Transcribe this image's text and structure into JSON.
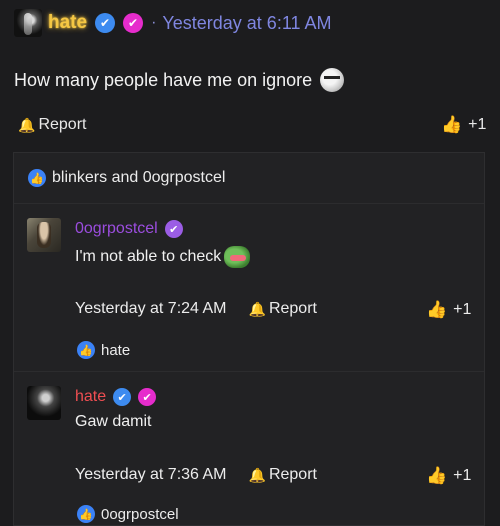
{
  "post": {
    "author": "hate",
    "time": "Yesterday at 6:11 AM",
    "separator": "·",
    "body": "How many people have me on ignore",
    "report_label": "Report",
    "like_label": "+1",
    "colors": {
      "author": "#f5c744",
      "time": "#7f86e0"
    }
  },
  "reactions_summary": "blinkers and 0ogrpostcel",
  "comments": [
    {
      "author": "0ogrpostcel",
      "author_color": "#9b4dde",
      "text": "I'm not able to check",
      "time": "Yesterday at 7:24 AM",
      "report_label": "Report",
      "like_label": "+1",
      "reacted_by": "hate"
    },
    {
      "author": "hate",
      "author_color": "#ef4e52",
      "text": "Gaw damit",
      "time": "Yesterday at 7:36 AM",
      "report_label": "Report",
      "like_label": "+1",
      "reacted_by": "0ogrpostcel"
    }
  ],
  "icons": {
    "verified": "check-badge-icon",
    "bell": "bell-icon",
    "thumb": "thumbs-up-icon"
  }
}
